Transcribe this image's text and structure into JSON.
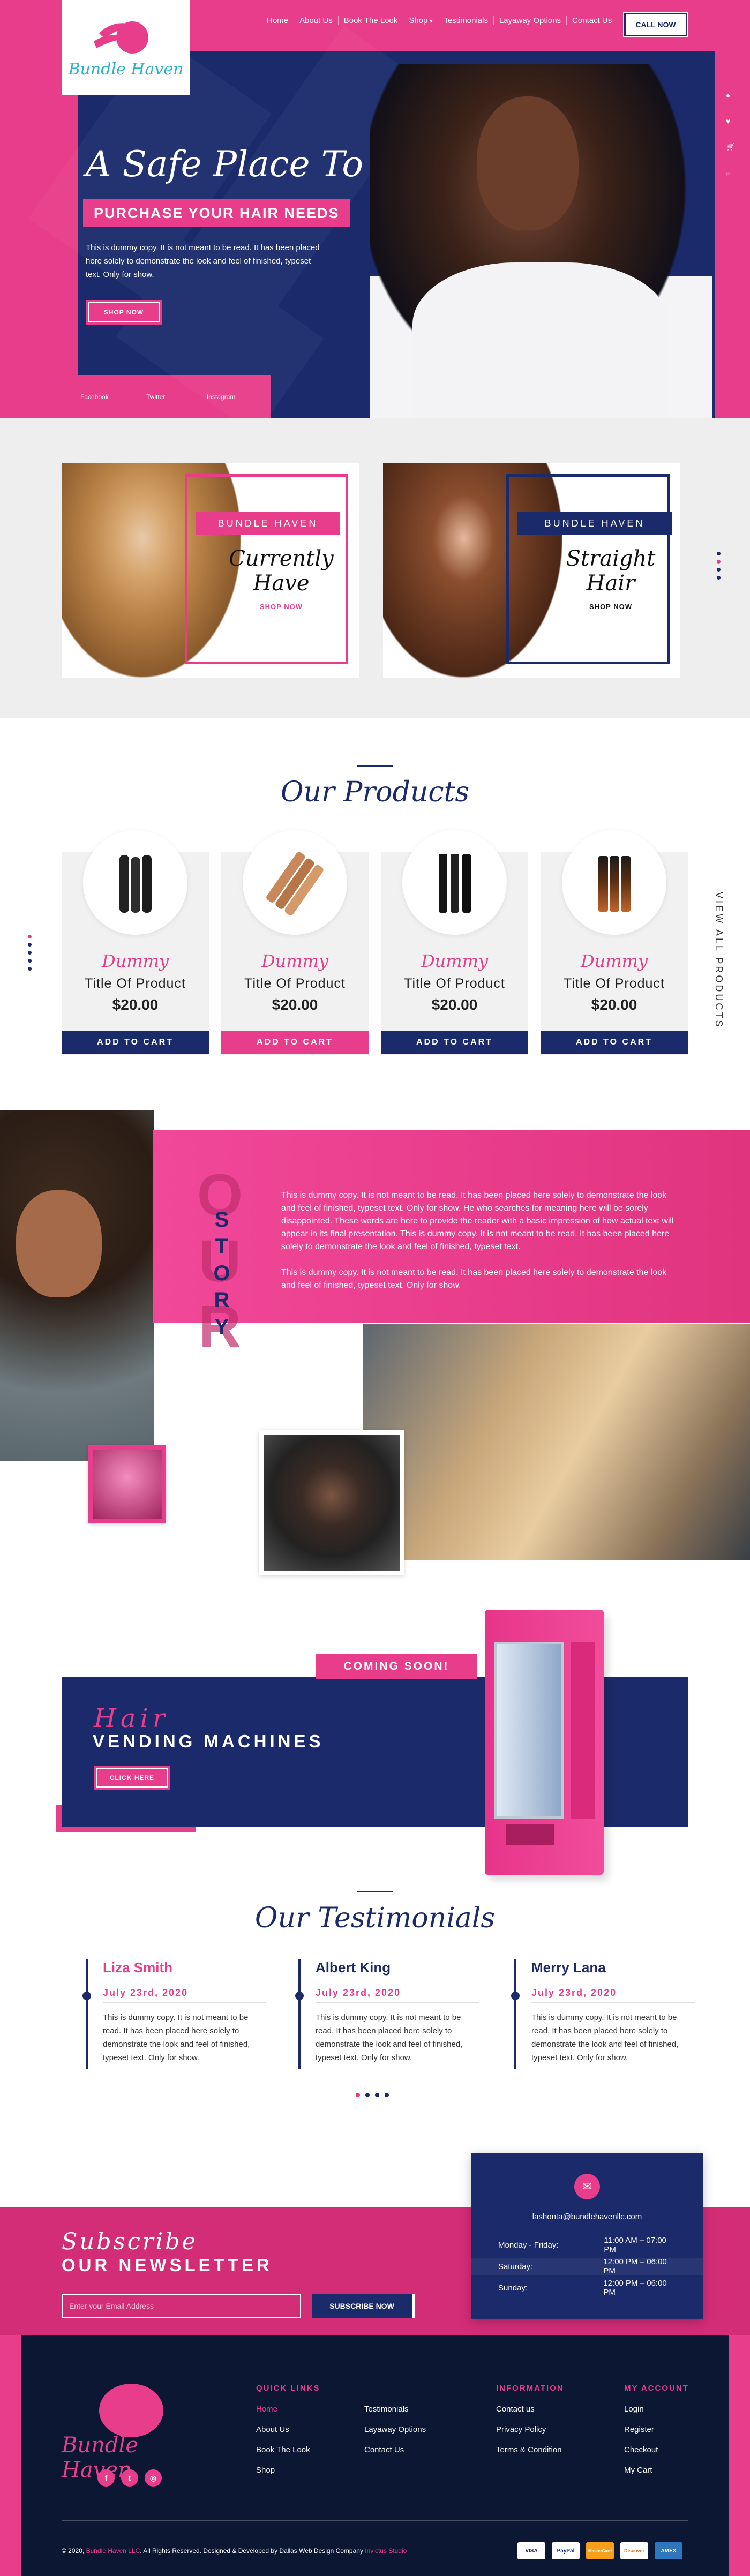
{
  "colors": {
    "pink": "#e83d8a",
    "navy": "#1b2a6b",
    "dark": "#0c1734",
    "cyan": "#2ab3c8"
  },
  "brand": {
    "logo_text": "Bundle Haven"
  },
  "nav": {
    "items": [
      "Home",
      "About Us",
      "Book The Look",
      "Shop",
      "Testimonials",
      "Layaway Options",
      "Contact Us"
    ],
    "call": "CALL NOW"
  },
  "side_icons": [
    "user-icon",
    "heart-icon",
    "cart-icon",
    "search-icon"
  ],
  "hero": {
    "title": "A Safe Place To",
    "subtitle": "PURCHASE YOUR HAIR NEEDS",
    "text": "This is dummy copy. It is not meant to be read. It has been placed here solely to demonstrate the look and feel of finished, typeset text. Only for show.",
    "button": "SHOP NOW",
    "social": [
      "Facebook",
      "Twitter",
      "Instagram"
    ]
  },
  "collections": [
    {
      "band": "BUNDLE HAVEN",
      "name": "Currently Have",
      "link": "SHOP NOW"
    },
    {
      "band": "BUNDLE HAVEN",
      "name": "Straight Hair",
      "link": "SHOP NOW"
    }
  ],
  "products": {
    "heading": "Our Products",
    "view_all": "VIEW ALL PRODUCTS",
    "items": [
      {
        "label": "Dummy",
        "title": "Title Of Product",
        "price": "$20.00",
        "button": "ADD TO CART"
      },
      {
        "label": "Dummy",
        "title": "Title Of Product",
        "price": "$20.00",
        "button": "ADD TO CART"
      },
      {
        "label": "Dummy",
        "title": "Title Of Product",
        "price": "$20.00",
        "button": "ADD TO CART"
      },
      {
        "label": "Dummy",
        "title": "Title Of Product",
        "price": "$20.00",
        "button": "ADD TO CART"
      }
    ]
  },
  "story": {
    "big": "OUR",
    "vertical": "STORY",
    "p1": "This is dummy copy. It is not meant to be read. It has been placed here solely to demonstrate the look and feel of finished, typeset text. Only for show. He who searches for meaning here will be sorely disappointed. These words are here to provide the reader with a basic impression of how actual text will appear in its final presentation. This is dummy copy. It is not meant to be read. It has been placed here solely to demonstrate the look and feel of finished, typeset text.",
    "p2": "This is dummy copy. It is not meant to be read. It has been placed here solely to demonstrate the look and feel of finished, typeset text. Only for show."
  },
  "vending": {
    "coming": "COMING SOON!",
    "hair": "Hair",
    "title": "VENDING MACHINES",
    "button": "CLICK HERE"
  },
  "testimonials": {
    "heading": "Our Testimonials",
    "items": [
      {
        "name": "Liza Smith",
        "date": "July 23rd, 2020",
        "text": "This is dummy copy. It is not meant to be read. It has been placed here solely to demonstrate the look and feel of finished, typeset text. Only for show."
      },
      {
        "name": "Albert King",
        "date": "July 23rd, 2020",
        "text": "This is dummy copy. It is not meant to be read. It has been placed here solely to demonstrate the look and feel of finished, typeset text. Only for show."
      },
      {
        "name": "Merry Lana",
        "date": "July 23rd, 2020",
        "text": "This is dummy copy. It is not meant to be read. It has been placed here solely to demonstrate the look and feel of finished, typeset text. Only for show."
      }
    ]
  },
  "newsletter": {
    "subtitle": "Subscribe",
    "title": "OUR NEWSLETTER",
    "placeholder": "Enter your Email Address",
    "button": "SUBSCRIBE NOW"
  },
  "hours": {
    "email": "lashonta@bundlehavenllc.com",
    "rows": [
      {
        "day": "Monday - Friday:",
        "time": "11:00 AM – 07:00 PM"
      },
      {
        "day": "Saturday:",
        "time": "12:00 PM – 06:00 PM"
      },
      {
        "day": "Sunday:",
        "time": "12:00 PM – 06:00 PM"
      }
    ]
  },
  "footer": {
    "logo_text": "Bundle Haven",
    "cols": [
      {
        "title": "QUICK LINKS",
        "items": [
          "Home",
          "About Us",
          "Book The Look",
          "Shop"
        ]
      },
      {
        "title": "",
        "items": [
          "Testimonials",
          "Layaway Options",
          "Contact Us"
        ]
      },
      {
        "title": "INFORMATION",
        "items": [
          "Contact us",
          "Privacy Policy",
          "Terms & Condition"
        ]
      },
      {
        "title": "MY ACCOUNT",
        "items": [
          "Login",
          "Register",
          "Checkout",
          "My Cart"
        ]
      }
    ],
    "copy_pre": "© 2020,",
    "copy_brand": "Bundle Haven LLC",
    "copy_mid": ". All Rights Reserved. Designed & Developed by Dallas Web Design Company",
    "copy_studio": "Invictus Studio",
    "payments": [
      "VISA",
      "PayPal",
      "MasterCard",
      "Discover",
      "AMEX"
    ]
  }
}
